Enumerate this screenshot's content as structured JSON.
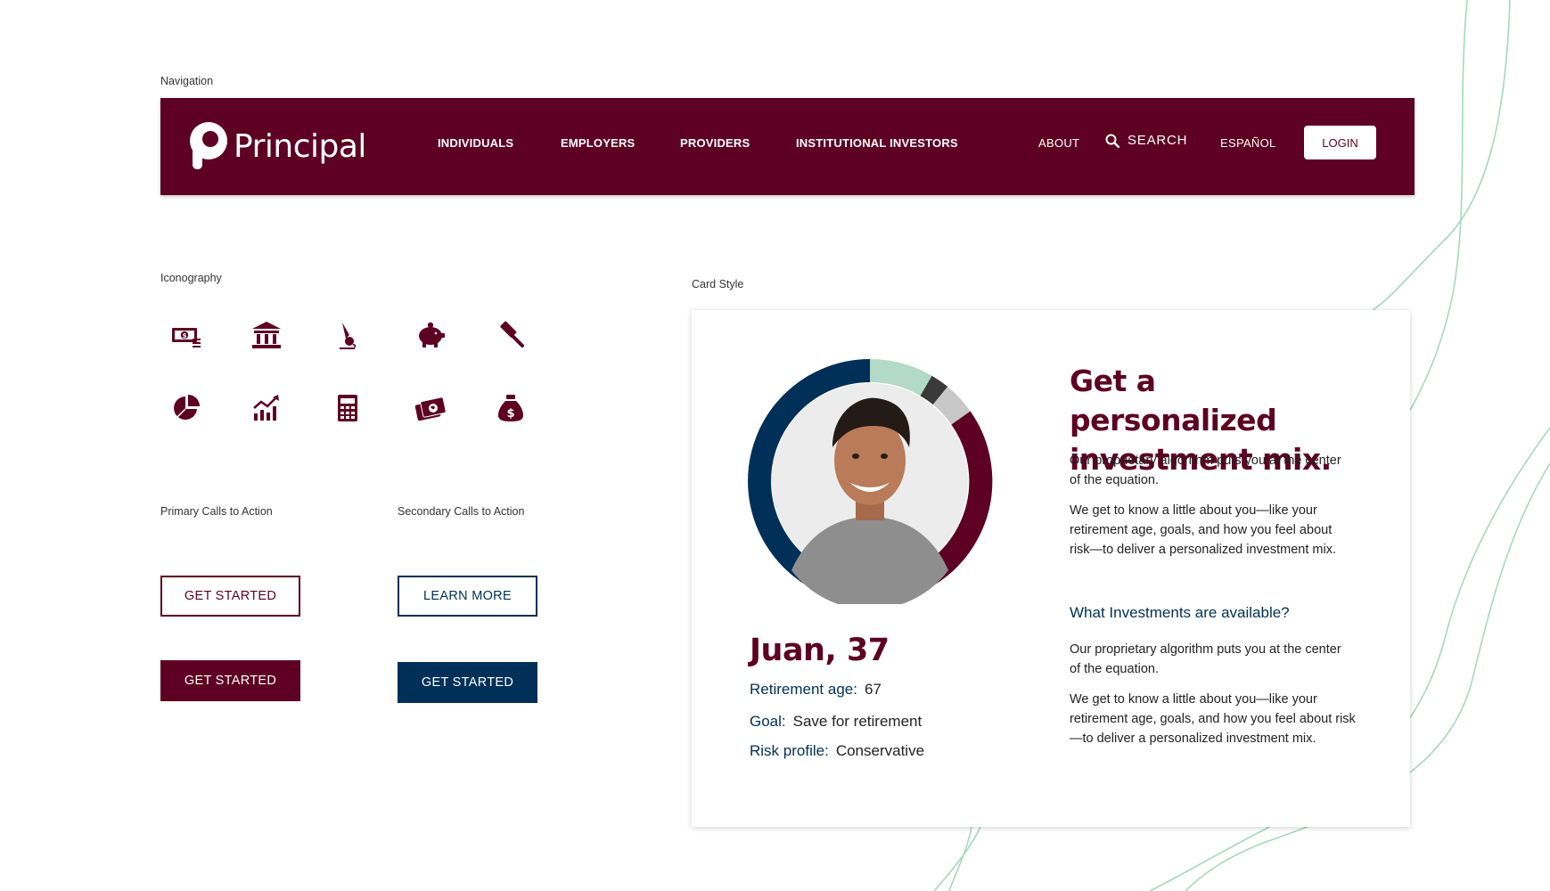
{
  "labels": {
    "navigation": "Navigation",
    "iconography": "Iconography",
    "primary_cta": "Primary Calls to Action",
    "secondary_cta": "Secondary Calls to Action",
    "card_style": "Card Style"
  },
  "nav": {
    "logo_text": "Principal",
    "items": [
      "INDIVIDUALS",
      "EMPLOYERS",
      "PROVIDERS",
      "INSTITUTIONAL INVESTORS"
    ],
    "about": "ABOUT",
    "search": "SEARCH",
    "espanol": "ESPAÑOL",
    "login": "LOGIN"
  },
  "icons": [
    "cash-icon",
    "bank-icon",
    "signature-pen-icon",
    "piggy-bank-icon",
    "gavel-icon",
    "pie-chart-icon",
    "growth-chart-icon",
    "calculator-icon",
    "world-card-icon",
    "money-bag-icon"
  ],
  "buttons": {
    "primary_outline": "GET STARTED",
    "primary_solid": "GET STARTED",
    "secondary_outline": "LEARN MORE",
    "secondary_solid": "GET STARTED"
  },
  "card": {
    "name": "Juan, 37",
    "retirement_age_label": "Retirement age:",
    "retirement_age": "67",
    "goal_label": "Goal:",
    "goal": "Save for retirement",
    "risk_label": "Risk profile:",
    "risk": "Conservative",
    "heading": "Get a personalized investment mix.",
    "p1": "Our proprietary algorithm puts you at the center of the equation.",
    "p2": "We get to know a little about you—like your retirement age, goals, and how you feel about risk—to deliver a personalized investment mix.",
    "link": "What Investments are available?",
    "p3": "Our proprietary algorithm puts you at the center of the equation.",
    "p4": "We get to know a little about you—like your retirement age, goals, and how you feel about risk—to deliver a personalized investment mix."
  },
  "colors": {
    "maroon": "#5e0022",
    "navy": "#003057",
    "mint": "#b3dac6",
    "deco_line": "#9fd4b8"
  }
}
